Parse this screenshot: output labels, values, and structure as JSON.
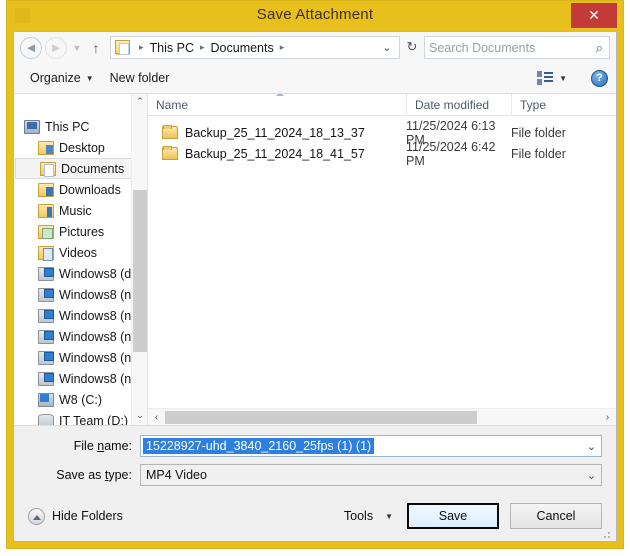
{
  "window": {
    "title": "Save Attachment",
    "close_label": "✕"
  },
  "nav": {
    "back_icon": "◄",
    "forward_icon": "►",
    "recent_icon": "▼",
    "up_icon": "↑",
    "breadcrumbs": [
      "This PC",
      "Documents"
    ],
    "separator": "▸",
    "dropdown_icon": "⌄",
    "refresh_icon": "↻",
    "search_placeholder": "Search Documents",
    "search_value": "",
    "search_icon": "⌕"
  },
  "toolbar": {
    "organize_label": "Organize",
    "organize_caret": "▼",
    "new_folder_label": "New folder",
    "view_caret": "▼",
    "help_label": "?"
  },
  "sidebar": {
    "items": [
      {
        "label": "This PC",
        "icon": "pc-icon",
        "level": 1,
        "selected": false
      },
      {
        "label": "Desktop",
        "icon": "folder-desktop-icon",
        "level": 2,
        "selected": false
      },
      {
        "label": "Documents",
        "icon": "folder-documents-icon",
        "level": 2,
        "selected": true
      },
      {
        "label": "Downloads",
        "icon": "folder-downloads-icon",
        "level": 2,
        "selected": false
      },
      {
        "label": "Music",
        "icon": "folder-music-icon",
        "level": 2,
        "selected": false
      },
      {
        "label": "Pictures",
        "icon": "folder-pictures-icon",
        "level": 2,
        "selected": false
      },
      {
        "label": "Videos",
        "icon": "folder-videos-icon",
        "level": 2,
        "selected": false
      },
      {
        "label": "Windows8 (d",
        "icon": "network-drive-icon",
        "level": 2,
        "selected": false
      },
      {
        "label": "Windows8 (n",
        "icon": "network-drive-icon",
        "level": 2,
        "selected": false
      },
      {
        "label": "Windows8 (n",
        "icon": "network-drive-icon",
        "level": 2,
        "selected": false
      },
      {
        "label": "Windows8 (n",
        "icon": "network-drive-icon",
        "level": 2,
        "selected": false
      },
      {
        "label": "Windows8 (n",
        "icon": "network-drive-icon",
        "level": 2,
        "selected": false
      },
      {
        "label": "Windows8 (n",
        "icon": "network-drive-icon",
        "level": 2,
        "selected": false
      },
      {
        "label": "W8 (C:)",
        "icon": "hard-disk-icon",
        "level": 2,
        "selected": false
      },
      {
        "label": "IT Team (D:)",
        "icon": "disk-icon",
        "level": 2,
        "selected": false
      }
    ],
    "scroll_up_icon": "⌃",
    "scroll_down_icon": "⌄"
  },
  "filelist": {
    "columns": [
      "Name",
      "Date modified",
      "Type"
    ],
    "sort_column": "Name",
    "sort_direction": "ascending",
    "rows": [
      {
        "name": "Backup_25_11_2024_18_13_37",
        "date": "11/25/2024 6:13 PM",
        "type": "File folder"
      },
      {
        "name": "Backup_25_11_2024_18_41_57",
        "date": "11/25/2024 6:42 PM",
        "type": "File folder"
      }
    ],
    "hscroll_left_icon": "‹",
    "hscroll_right_icon": "›"
  },
  "form": {
    "filename_label_pre": "File ",
    "filename_label_accel": "n",
    "filename_label_post": "ame:",
    "filename_value": "15228927-uhd_3840_2160_25fps (1) (1)",
    "filename_selected": true,
    "savetype_label_pre": "Save as ",
    "savetype_label_accel": "t",
    "savetype_label_post": "ype:",
    "savetype_value": "MP4 Video",
    "dropdown_icon": "⌄"
  },
  "footer": {
    "hide_folders_label": "Hide Folders",
    "tools_label": "Tools",
    "tools_caret": "▼",
    "save_label": "Save",
    "cancel_label": "Cancel"
  },
  "colors": {
    "frame": "#e8c01e",
    "close_button": "#c23b38",
    "selection_blue": "#2f7fe0",
    "folder_yellow": "#f0c257"
  }
}
